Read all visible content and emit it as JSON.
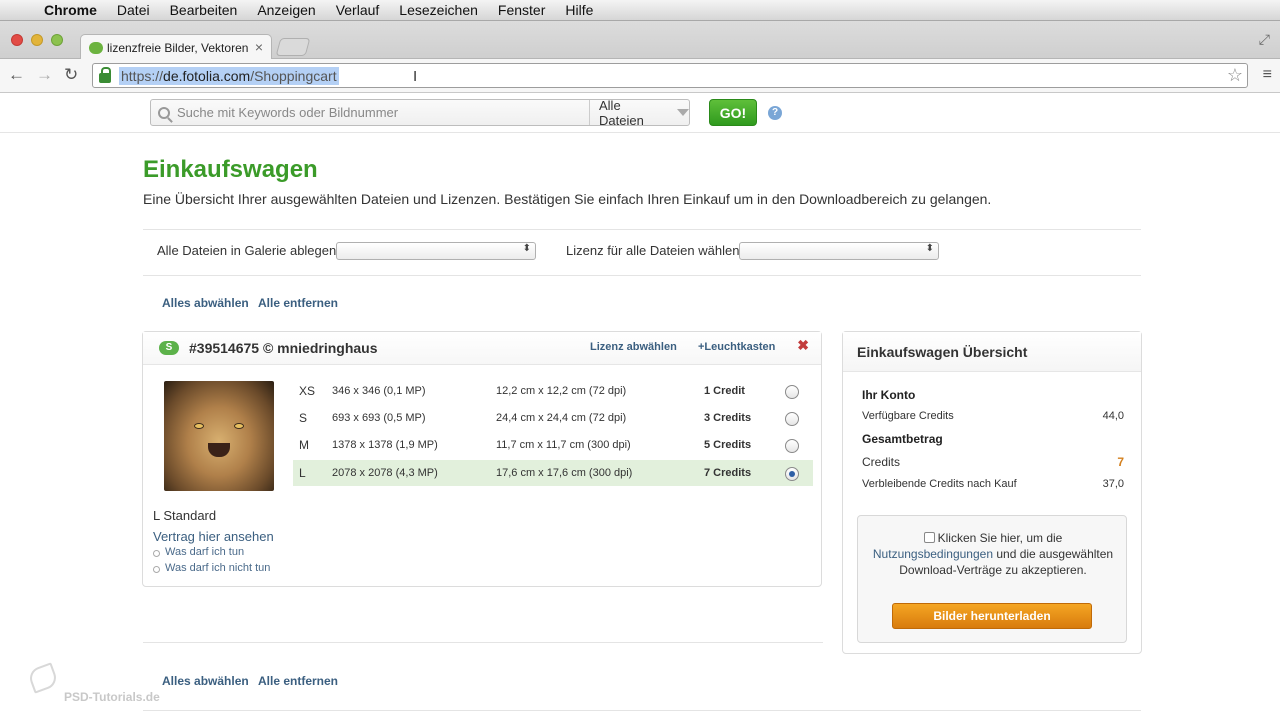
{
  "menubar": {
    "app": "Chrome",
    "items": [
      "Datei",
      "Bearbeiten",
      "Anzeigen",
      "Verlauf",
      "Lesezeichen",
      "Fenster",
      "Hilfe"
    ]
  },
  "tab": {
    "title": "lizenzfreie Bilder, Vektoren",
    "close": "×"
  },
  "omnibox": {
    "scheme": "https://",
    "host": "de.fotolia.com",
    "path": "/Shoppingcart"
  },
  "search": {
    "placeholder": "Suche mit Keywords oder Bildnummer",
    "filter": "Alle Dateien",
    "go_label": "GO!",
    "help": "?"
  },
  "page": {
    "title": "Einkaufswagen",
    "description": "Eine Übersicht Ihrer ausgewählten Dateien und Lizenzen. Bestätigen Sie einfach Ihren Einkauf um in den Downloadbereich zu gelangen.",
    "gallery_label": "Alle Dateien in Galerie ablegen",
    "license_label": "Lizenz für alle Dateien wählen",
    "select_all": "Alles abwählen",
    "remove_all": "Alle entfernen"
  },
  "item": {
    "badge": "S",
    "id": "#39514675 © mniedringhaus",
    "deselect_license": "Lizenz abwählen",
    "lightbox": "+Leuchtkasten",
    "remove": "✖",
    "sizes": [
      {
        "code": "XS",
        "pixels": "346 x 346 (0,1 MP)",
        "print": "12,2 cm x 12,2 cm (72 dpi)",
        "credits": "1 Credit",
        "selected": false
      },
      {
        "code": "S",
        "pixels": "693 x 693 (0,5 MP)",
        "print": "24,4 cm x 24,4 cm (72 dpi)",
        "credits": "3 Credits",
        "selected": false
      },
      {
        "code": "M",
        "pixels": "1378 x 1378 (1,9 MP)",
        "print": "11,7 cm x 11,7 cm (300 dpi)",
        "credits": "5 Credits",
        "selected": false
      },
      {
        "code": "L",
        "pixels": "2078 x 2078 (4,3 MP)",
        "print": "17,6 cm x 17,6 cm (300 dpi)",
        "credits": "7 Credits",
        "selected": true
      }
    ],
    "license_name": "L Standard",
    "contract_link": "Vertrag hier ansehen",
    "may_do": "Was darf ich tun",
    "may_not_do": "Was darf ich nicht tun"
  },
  "summary": {
    "title": "Einkaufswagen Übersicht",
    "account_heading": "Ihr Konto",
    "available_label": "Verfügbare Credits",
    "available_value": "44,0",
    "total_heading": "Gesamtbetrag",
    "credits_label": "Credits",
    "credits_value": "7",
    "remaining_label": "Verbleibende Credits nach Kauf",
    "remaining_value": "37,0",
    "terms_prefix": "Klicken Sie hier, um die",
    "terms_link": "Nutzungsbedingungen",
    "terms_suffix": "und die ausgewählten Download-Verträge zu akzeptieren.",
    "download_button": "Bilder herunterladen"
  },
  "watermark": "PSD-Tutorials.de",
  "colors": {
    "title_green": "#3b9b29",
    "go_green": "#2f9a1e",
    "link_blue": "#3b5f80",
    "download_orange": "#d87b0d",
    "selected_row": "#e2f0dc"
  }
}
